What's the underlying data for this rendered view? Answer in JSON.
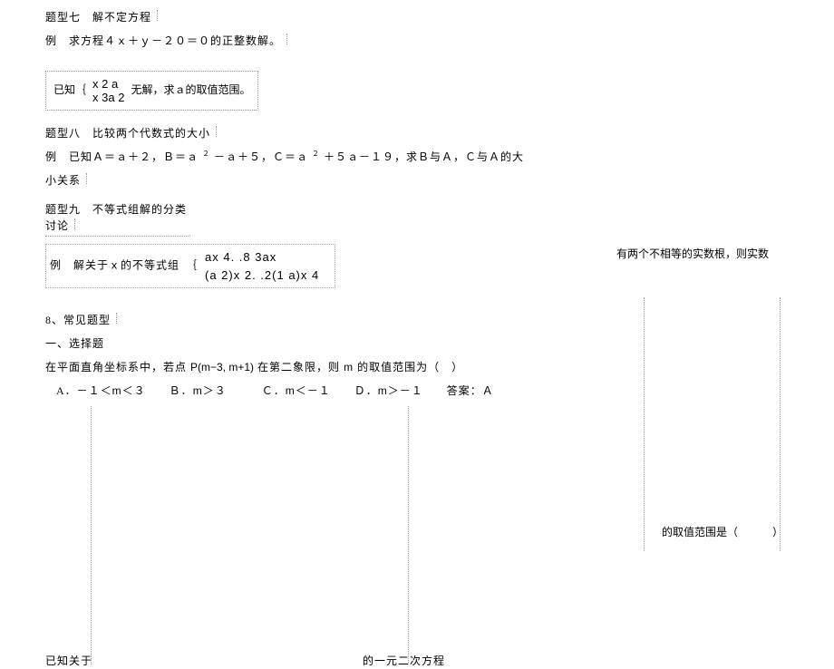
{
  "section7": {
    "title": "题型七　解不定方程",
    "example": "例　求方程４ｘ＋ｙ－２０＝０的正整数解。"
  },
  "boxed1": {
    "lead": "已知｛",
    "row1": "x   2  a",
    "row2": "x  3a    2",
    "tail": "无解，求ａ的取值范围。"
  },
  "section8": {
    "title": "题型八　比较两个代数式的大小",
    "example_lead": "例　已知Ａ＝ａ＋２，Ｂ＝ａ",
    "example_mid": "－ａ＋５，Ｃ＝ａ",
    "example_tail": "＋５ａ－１９，求Ｂ与Ａ，Ｃ与Ａ的大",
    "example_cont": "小关系"
  },
  "section9": {
    "title": "题型九　不等式组解的分类讨论",
    "example_lead": "例　解关于ｘ的不等式组　｛",
    "sys_row1": "ax  4. .8  3ax",
    "sys_row2": "(a  2)x  2. .2(1  a)x  4"
  },
  "right1": "有两个不相等的实数根，则实数",
  "common": {
    "heading": "8、常见题型",
    "sub1": "一、选择题",
    "desc_lead": "在平面直角坐标系中，若点",
    "desc_point": "P(m−3, m+1)",
    "desc_tail": "在第二象限，则",
    "desc_m": "m",
    "desc_end": "的取值范围为（　）"
  },
  "choices": {
    "a_lead": "A．－１＜",
    "a_m": "m",
    "a_tail": "＜３　　Ｂ．",
    "b_m": "m",
    "b_tail": "＞３　　　Ｃ．",
    "c_m": "m",
    "c_tail": "＜－１　　Ｄ．",
    "d_m": "m",
    "d_tail": "＞－１　　答案：Ａ"
  },
  "right2": {
    "text": "的取值范围是（",
    "close": "）"
  },
  "bottom": {
    "lead": "已知关于",
    "tail": "的一元二次方程"
  }
}
